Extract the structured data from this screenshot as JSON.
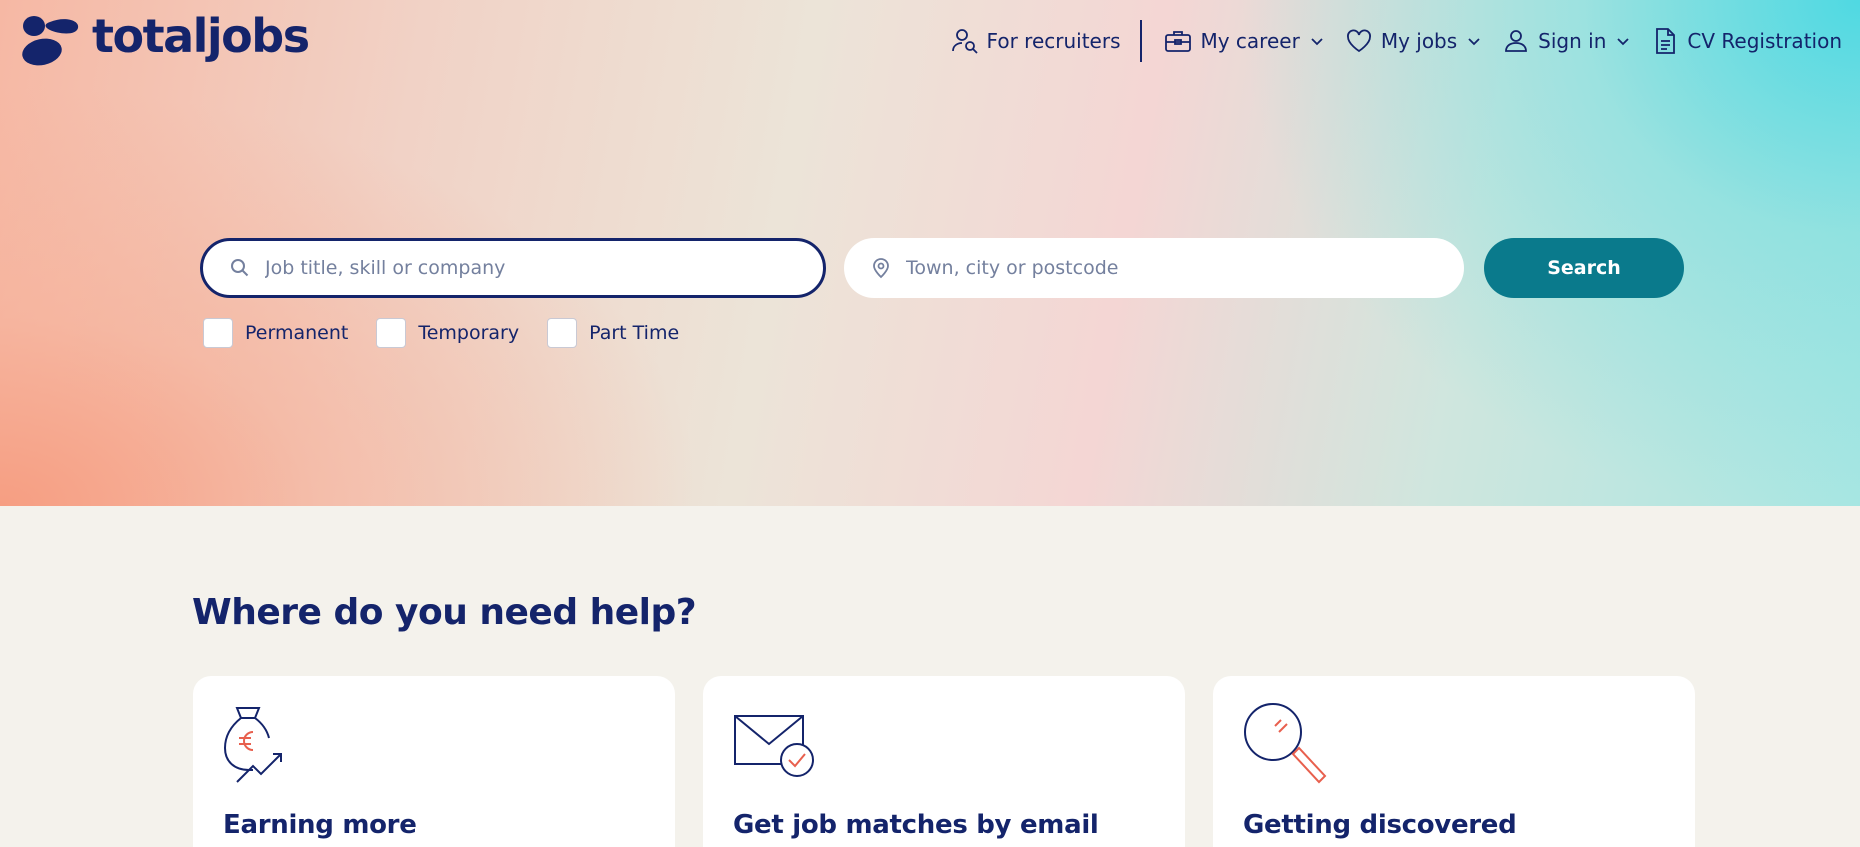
{
  "brand": {
    "name": "totaljobs",
    "navy": "#14246b",
    "teal": "#0a7a8c",
    "coral": "#e8604e"
  },
  "nav": {
    "recruiters": "For recruiters",
    "career": "My career",
    "jobs": "My jobs",
    "signin": "Sign in",
    "cv": "CV Registration"
  },
  "search": {
    "what_placeholder": "Job title, skill or company",
    "what_value": "",
    "where_placeholder": "Town, city or postcode",
    "where_value": "",
    "button_label": "Search"
  },
  "filters": [
    {
      "label": "Permanent",
      "checked": false
    },
    {
      "label": "Temporary",
      "checked": false
    },
    {
      "label": "Part Time",
      "checked": false
    }
  ],
  "help": {
    "title": "Where do you need help?",
    "cards": [
      {
        "title": "Earning more",
        "icon": "money-bag-icon"
      },
      {
        "title": "Get job matches by email",
        "icon": "envelope-check-icon"
      },
      {
        "title": "Getting discovered",
        "icon": "magnifier-icon"
      }
    ]
  }
}
